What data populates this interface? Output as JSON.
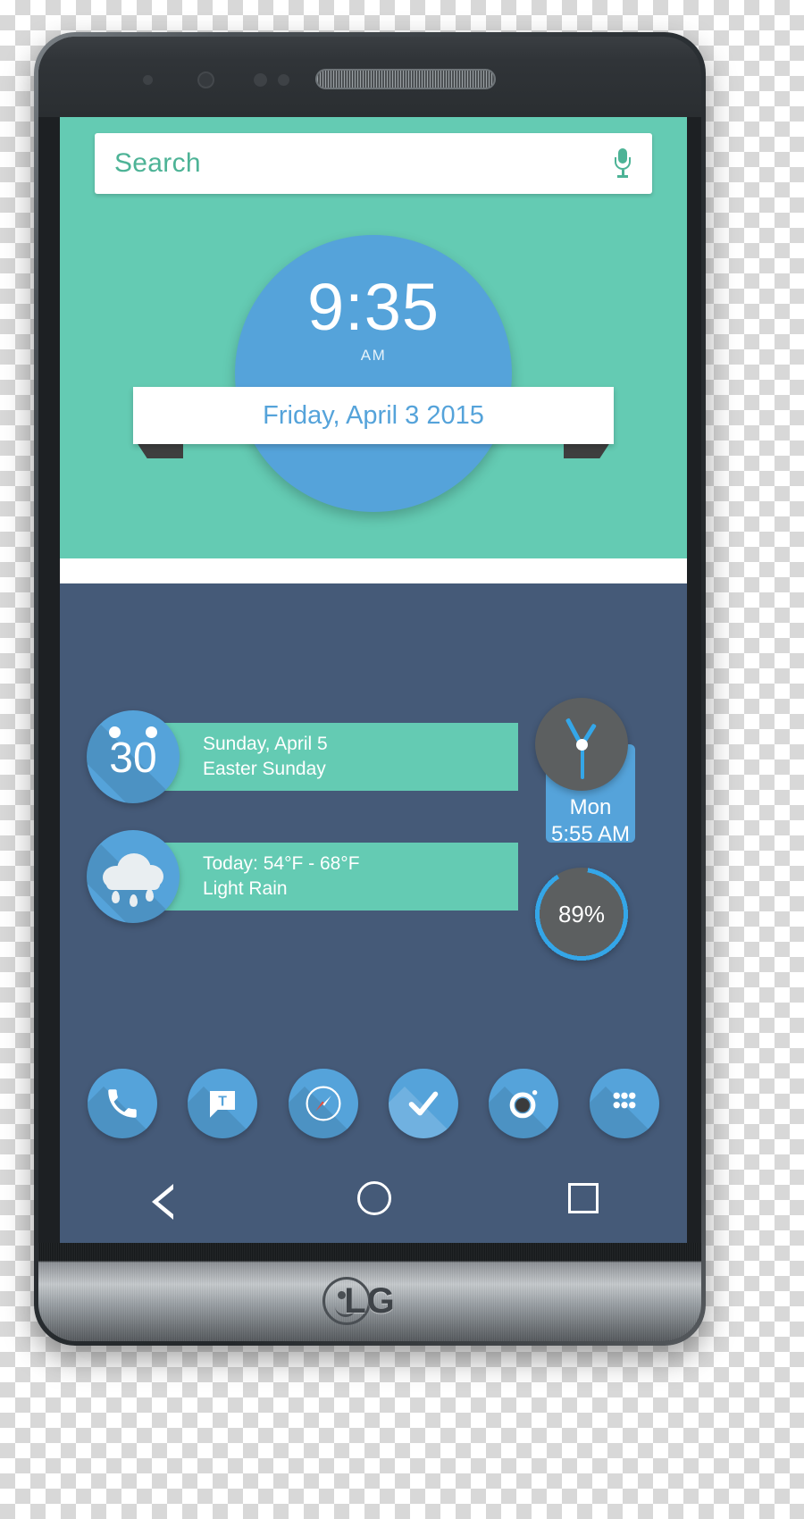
{
  "device": {
    "brand": "LG",
    "type": "smartphone",
    "model_label": "LG"
  },
  "screen": {
    "search": {
      "placeholder": "Search",
      "mic_icon": "microphone-icon"
    },
    "clock_widget": {
      "time": "9:35",
      "meridiem": "AM",
      "date": "Friday, April 3 2015",
      "circle_color": "#55a3da",
      "panel_color": "#64cbb3"
    },
    "widgets": [
      {
        "id": "calendar",
        "icon": "calendar-alarm-icon",
        "badge": "30",
        "line1": "Sunday, April 5",
        "line2": "Easter Sunday"
      },
      {
        "id": "weather",
        "icon": "rain-cloud-icon",
        "line1": "Today: 54°F - 68°F",
        "line2": "Light Rain"
      }
    ],
    "analog_clock": {
      "icon": "analog-clock-icon",
      "day": "Mon",
      "time": "5:55 AM"
    },
    "battery": {
      "icon": "battery-ring-icon",
      "percent": "89%",
      "value": 89
    },
    "dock": [
      {
        "id": "phone",
        "icon": "phone-icon",
        "label": "Phone"
      },
      {
        "id": "messages",
        "icon": "message-bubble-icon",
        "label": "Messages"
      },
      {
        "id": "browser",
        "icon": "compass-icon",
        "label": "Browser"
      },
      {
        "id": "tasks",
        "icon": "checkmark-icon",
        "label": "Tasks"
      },
      {
        "id": "camera",
        "icon": "camera-icon",
        "label": "Camera"
      },
      {
        "id": "app-drawer",
        "icon": "app-grid-icon",
        "label": "Apps"
      }
    ],
    "navbar": [
      {
        "id": "back",
        "icon": "back-triangle-icon",
        "label": "Back"
      },
      {
        "id": "home",
        "icon": "home-circle-icon",
        "label": "Home"
      },
      {
        "id": "recents",
        "icon": "recents-square-icon",
        "label": "Recents"
      }
    ]
  },
  "colors": {
    "accent_green": "#64cbb3",
    "accent_blue": "#55a3da",
    "wallpaper": "#455a78",
    "ring_blue": "#34a6e8",
    "widget_face": "#5c5f60"
  }
}
